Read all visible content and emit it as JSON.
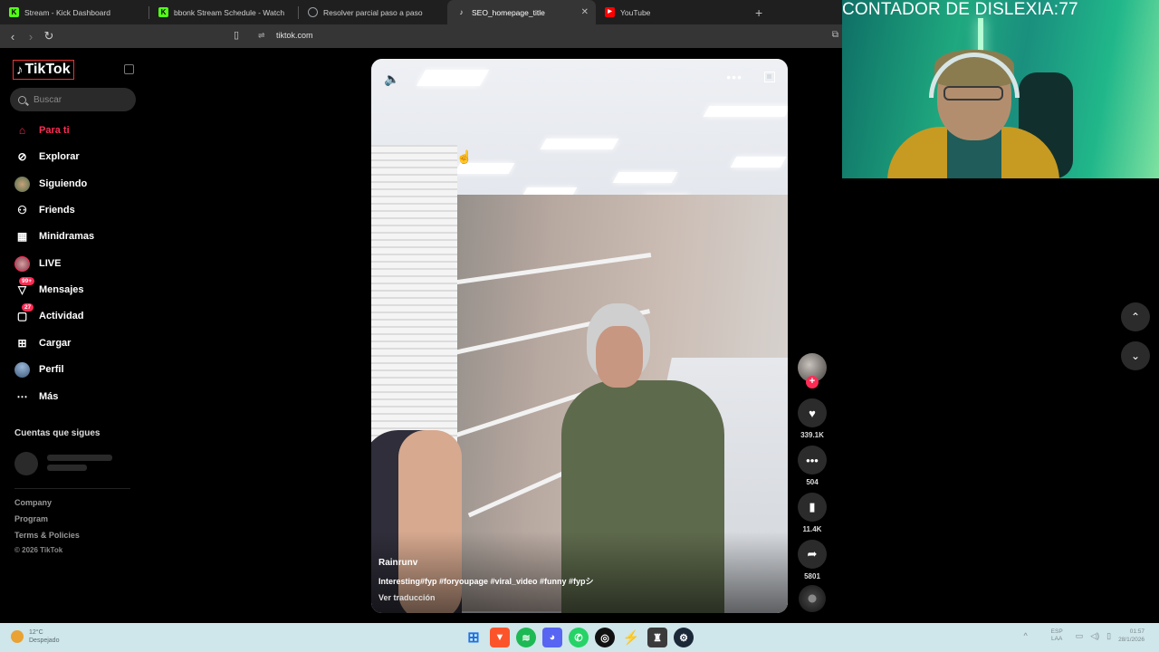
{
  "browser": {
    "tabs": [
      {
        "title": "Stream - Kick Dashboard",
        "icon": "kick-icon",
        "color": "#53fc18",
        "active": false
      },
      {
        "title": "bbonk Stream Schedule - Watch",
        "icon": "kick-icon",
        "color": "#53fc18",
        "active": false
      },
      {
        "title": "Resolver parcial paso a paso",
        "icon": "page-icon",
        "color": "#9aa0a6",
        "active": false
      },
      {
        "title": "SEO_homepage_title",
        "icon": "tiktok-icon",
        "color": "#000000",
        "active": true
      },
      {
        "title": "YouTube",
        "icon": "youtube-icon",
        "color": "#ff0000",
        "active": false
      }
    ],
    "url": "tiktok.com"
  },
  "sidebar": {
    "logo": "TikTok",
    "search_placeholder": "Buscar",
    "nav": [
      {
        "label": "Para ti",
        "icon": "home-icon",
        "active": true
      },
      {
        "label": "Explorar",
        "icon": "compass-icon"
      },
      {
        "label": "Siguiendo",
        "icon": "following-avatar-icon"
      },
      {
        "label": "Friends",
        "icon": "friends-icon"
      },
      {
        "label": "Minidramas",
        "icon": "film-icon"
      },
      {
        "label": "LIVE",
        "icon": "live-avatar-icon"
      },
      {
        "label": "Mensajes",
        "icon": "messages-icon",
        "badge": "99+"
      },
      {
        "label": "Actividad",
        "icon": "activity-icon",
        "badge": "27"
      },
      {
        "label": "Cargar",
        "icon": "upload-icon"
      },
      {
        "label": "Perfil",
        "icon": "profile-avatar-icon"
      },
      {
        "label": "Más",
        "icon": "more-icon"
      }
    ],
    "following_title": "Cuentas que sigues",
    "footer_links": [
      "Company",
      "Program",
      "Terms & Policies"
    ],
    "copyright": "© 2026 TikTok"
  },
  "video": {
    "author": "Rainrunv",
    "caption": "Interesting#fyp #foryoupage #viral_video #funny #fypシ",
    "translate": "Ver traducción"
  },
  "actions": {
    "likes": "339.1K",
    "comments": "504",
    "saves": "11.4K",
    "shares": "5801"
  },
  "webcam": {
    "counter": "CONTADOR DE DISLEXIA:77"
  },
  "taskbar": {
    "weather_temp": "12°C",
    "weather_desc": "Despejado",
    "lang_line1": "ESP",
    "lang_line2": "LAA",
    "time": "01:57",
    "date": "28/1/2026"
  },
  "colors": {
    "accent": "#fe2c55",
    "background": "#000000",
    "webcam_green": "#1fa97f"
  }
}
